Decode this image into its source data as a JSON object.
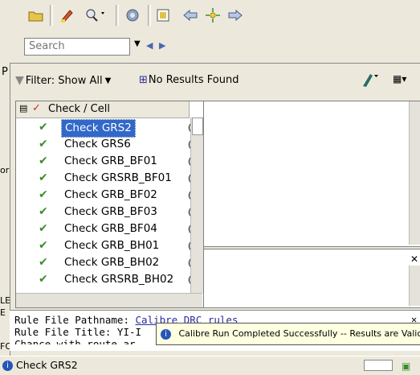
{
  "toolbar": {
    "buttons": [
      "open-folder-icon",
      "highlight-icon",
      "zoom-icon",
      "settings-icon",
      "grid-icon",
      "back-icon",
      "target-icon",
      "forward-icon"
    ]
  },
  "search": {
    "placeholder": "Search"
  },
  "left_letters": [
    "P",
    "or",
    "LE",
    "E",
    "FO"
  ],
  "filter": {
    "label": "Filter: Show All",
    "results_label": "No Results Found"
  },
  "list": {
    "header": "Check / Cell",
    "rows": [
      {
        "label": "Check GRS2",
        "selected": true
      },
      {
        "label": "Check GRS6"
      },
      {
        "label": "Check GRB_BF01"
      },
      {
        "label": "Check GRSRB_BF01"
      },
      {
        "label": "Check GRB_BF02"
      },
      {
        "label": "Check GRB_BF03"
      },
      {
        "label": "Check GRB_BF04"
      },
      {
        "label": "Check GRB_BH01"
      },
      {
        "label": "Check GRB_BH02"
      },
      {
        "label": "Check GRSRB_BH02"
      }
    ],
    "edge_char": "("
  },
  "console": {
    "line1_label": "Rule File Pathname:",
    "line1_value": "Calibre DRC rules",
    "line2_label": "Rule File Title: YI-I",
    "line3": "Chance with route ar"
  },
  "toast": {
    "message": "Calibre Run Completed Successfully -- Results are Valic"
  },
  "status": {
    "text": "Check GRS2"
  },
  "colors": {
    "accent": "#3168c9",
    "check_green": "#3c8c2c",
    "link": "#2a2aa0"
  }
}
